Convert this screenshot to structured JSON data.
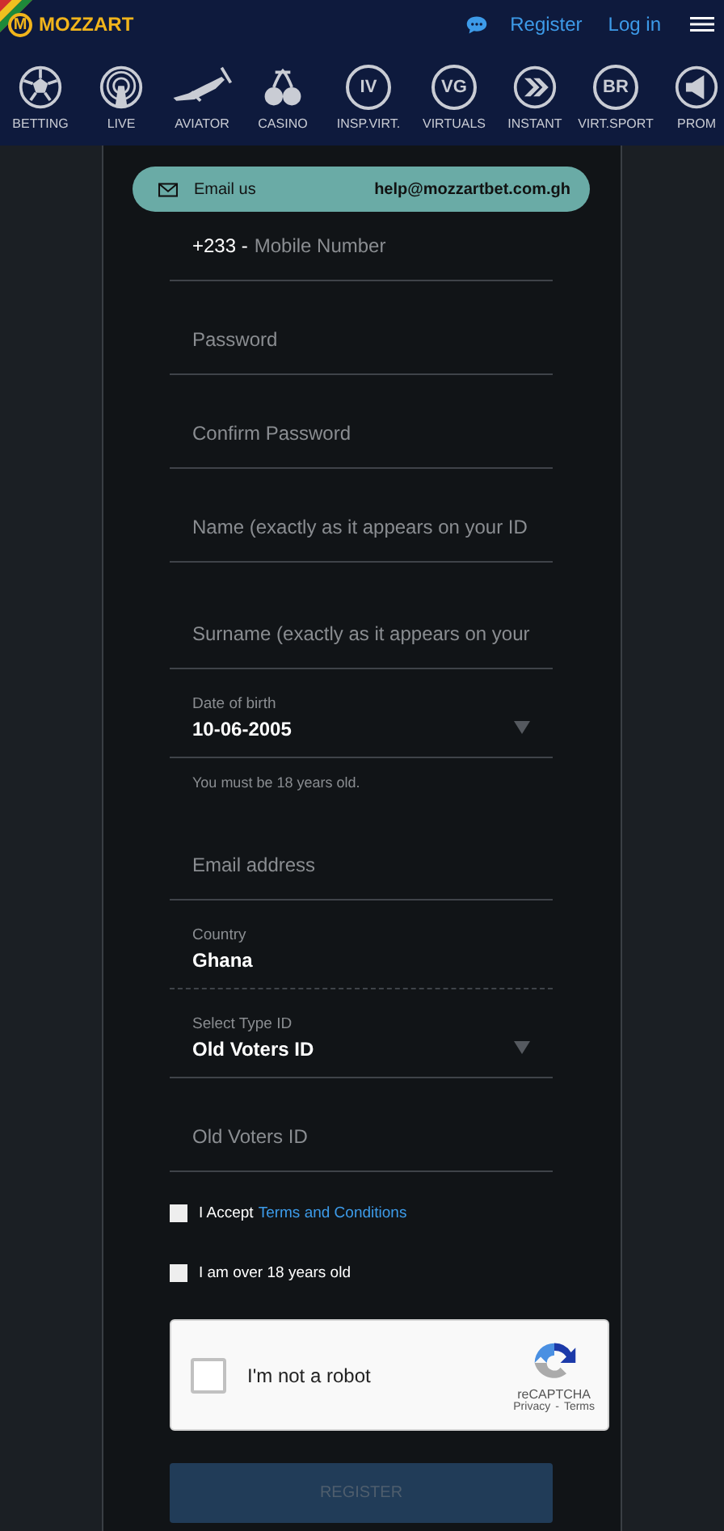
{
  "header": {
    "logo_mark": "M",
    "logo_text": "MOZZART",
    "links": [
      "Register",
      "Log in"
    ]
  },
  "nav": [
    {
      "kind": "ball",
      "label": "BETTING"
    },
    {
      "kind": "live",
      "label": "LIVE"
    },
    {
      "kind": "plane",
      "label": "AVIATOR"
    },
    {
      "kind": "cherries",
      "label": "CASINO"
    },
    {
      "kind": "letters",
      "mark": "IV",
      "label": "INSP.VIRT."
    },
    {
      "kind": "letters",
      "mark": "VG",
      "label": "VIRTUALS"
    },
    {
      "kind": "arrows",
      "label": "INSTANT"
    },
    {
      "kind": "letters",
      "mark": "BR",
      "label": "VIRT.SPORT"
    },
    {
      "kind": "megaphone",
      "label": "PROM"
    }
  ],
  "contact": {
    "label": "Email us",
    "email": "help@mozzartbet.com.gh"
  },
  "fields": [
    {
      "kind": "phone",
      "prefix": "+233 -",
      "placeholder": "Mobile Number"
    },
    {
      "kind": "text",
      "placeholder": "Password"
    },
    {
      "kind": "text",
      "placeholder": "Confirm Password"
    },
    {
      "kind": "text",
      "placeholder": "Name (exactly as it appears on your ID"
    },
    {
      "kind": "text",
      "placeholder": "Surname (exactly as it appears on your"
    },
    {
      "kind": "select",
      "label": "Date of birth",
      "value": "10-06-2005",
      "hint": "You must be 18 years old."
    },
    {
      "kind": "text",
      "placeholder": "Email address"
    },
    {
      "kind": "static",
      "label": "Country",
      "value": "Ghana"
    },
    {
      "kind": "select",
      "label": "Select Type ID",
      "value": "Old Voters ID"
    },
    {
      "kind": "text",
      "placeholder": "Old Voters ID"
    }
  ],
  "checks": [
    {
      "text": "I Accept",
      "link": "Terms and Conditions",
      "checked": false
    },
    {
      "text": "I am over 18 years old",
      "checked": false
    }
  ],
  "captcha": {
    "label": "I'm not a robot",
    "checked": false,
    "brand": "reCAPTCHA",
    "privacy": "Privacy",
    "separator": "-",
    "terms": "Terms"
  },
  "register": {
    "label": "REGISTER",
    "disabled": true
  }
}
